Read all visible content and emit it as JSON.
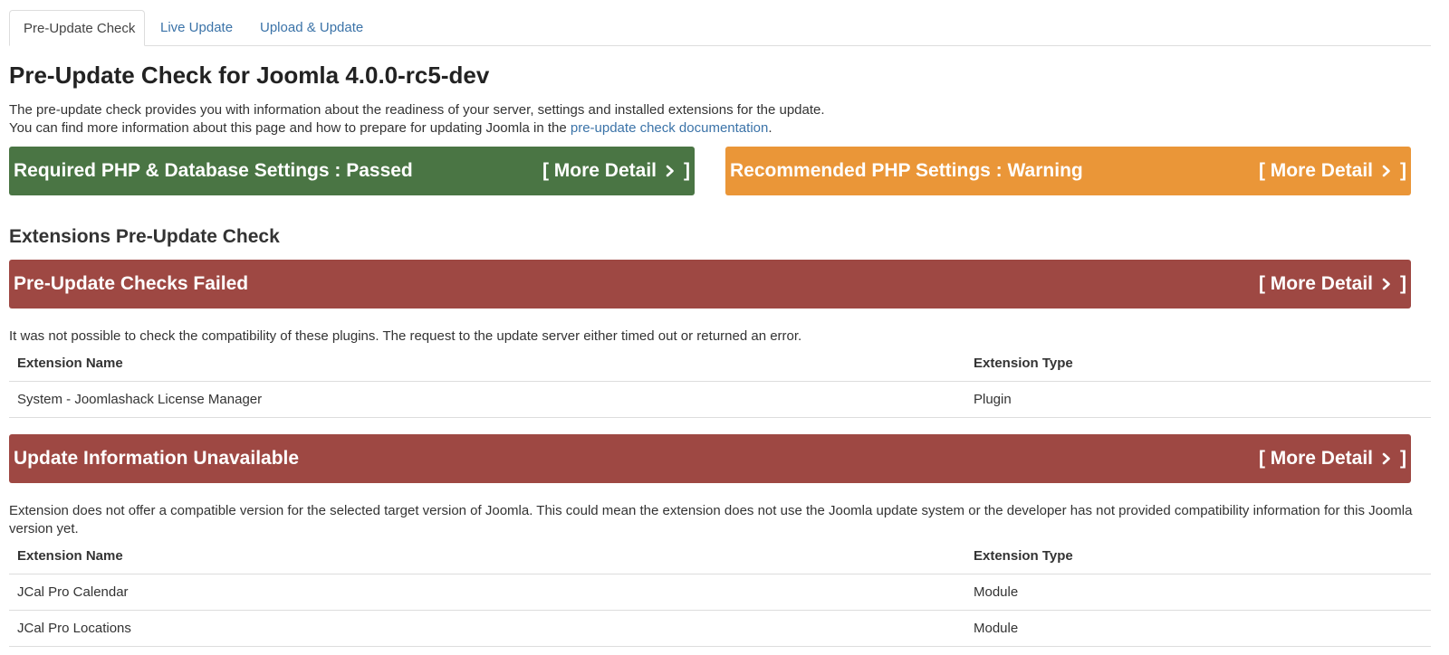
{
  "tabs": [
    {
      "label": "Pre-Update Check"
    },
    {
      "label": "Live Update"
    },
    {
      "label": "Upload & Update"
    }
  ],
  "title": "Pre-Update Check for Joomla 4.0.0-rc5-dev",
  "intro": {
    "line1": "The pre-update check provides you with information about the readiness of your server, settings and installed extensions for the update.",
    "line2_prefix": "You can find more information about this page and how to prepare for updating Joomla in the ",
    "link_text": "pre-update check documentation",
    "line2_suffix": "."
  },
  "status_bars": [
    {
      "title": "Required PHP & Database Settings : Passed",
      "link": "[ More Detail",
      "link_end": "]",
      "color": "#4a7544"
    },
    {
      "title": "Recommended PHP Settings : Warning",
      "link": "[ More Detail",
      "link_end": "]",
      "color": "#ea9638"
    }
  ],
  "extensions": {
    "heading": "Extensions Pre-Update Check",
    "groups": [
      {
        "title": "Pre-Update Checks Failed",
        "link": "[ More Detail",
        "link_end": "]",
        "color": "#9e4843",
        "description": "It was not possible to check the compatibility of these plugins. The request to the update server either timed out or returned an error.",
        "columns": [
          "Extension Name",
          "Extension Type"
        ],
        "rows": [
          {
            "name": "System - Joomlashack License Manager",
            "type": "Plugin"
          }
        ]
      },
      {
        "title": "Update Information Unavailable",
        "link": "[ More Detail",
        "link_end": "]",
        "color": "#9e4843",
        "description": "Extension does not offer a compatible version for the selected target version of Joomla. This could mean the extension does not use the Joomla update system or the developer has not provided compatibility information for this Joomla version yet.",
        "columns": [
          "Extension Name",
          "Extension Type"
        ],
        "rows": [
          {
            "name": "JCal Pro Calendar",
            "type": "Module"
          },
          {
            "name": "JCal Pro Locations",
            "type": "Module"
          }
        ]
      }
    ]
  }
}
